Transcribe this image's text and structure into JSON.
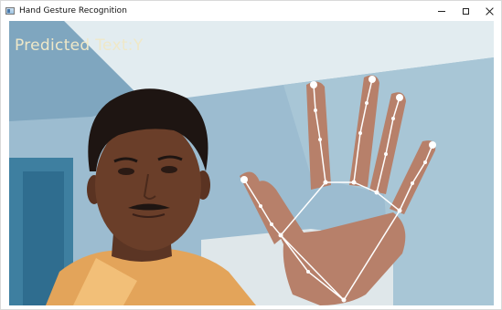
{
  "window": {
    "title": "Hand Gesture Recognition",
    "icon": "app-window-icon",
    "controls": [
      "minimize-icon",
      "maximize-icon",
      "close-icon"
    ]
  },
  "overlay": {
    "prediction_label": "Predicted Text:",
    "prediction_value": "Y",
    "prediction_text": "Predicted Text:Y",
    "text_color": "#efe8c8"
  },
  "landmarks": {
    "count": 21,
    "line_color": "#ffffff",
    "point_color": "#ffffff"
  }
}
